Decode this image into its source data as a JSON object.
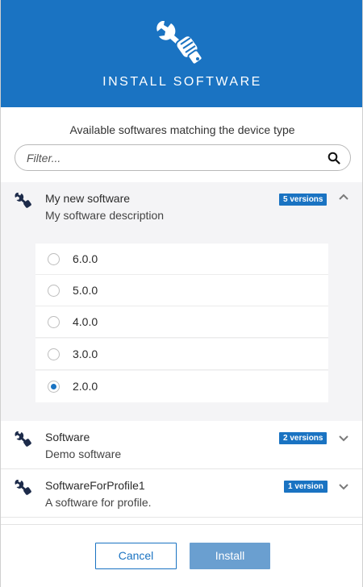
{
  "header": {
    "title": "INSTALL SOFTWARE",
    "icon": "wrench-hand-icon"
  },
  "subtitle": "Available softwares matching the device type",
  "filter": {
    "placeholder": "Filter...",
    "value": ""
  },
  "softwares": [
    {
      "name": "My new software",
      "description": "My software description",
      "badge": "5 versions",
      "expanded": true
    },
    {
      "name": "Software",
      "description": "Demo software",
      "badge": "2 versions",
      "expanded": false
    },
    {
      "name": "SoftwareForProfile1",
      "description": "A software for profile.",
      "badge": "1 version",
      "expanded": false
    }
  ],
  "versions": [
    {
      "label": "6.0.0",
      "selected": false
    },
    {
      "label": "5.0.0",
      "selected": false
    },
    {
      "label": "4.0.0",
      "selected": false
    },
    {
      "label": "3.0.0",
      "selected": false
    },
    {
      "label": "2.0.0",
      "selected": true
    }
  ],
  "footer": {
    "cancel_label": "Cancel",
    "install_label": "Install"
  },
  "colors": {
    "accent": "#1a73c2",
    "install_disabled": "#6a9fd0"
  }
}
